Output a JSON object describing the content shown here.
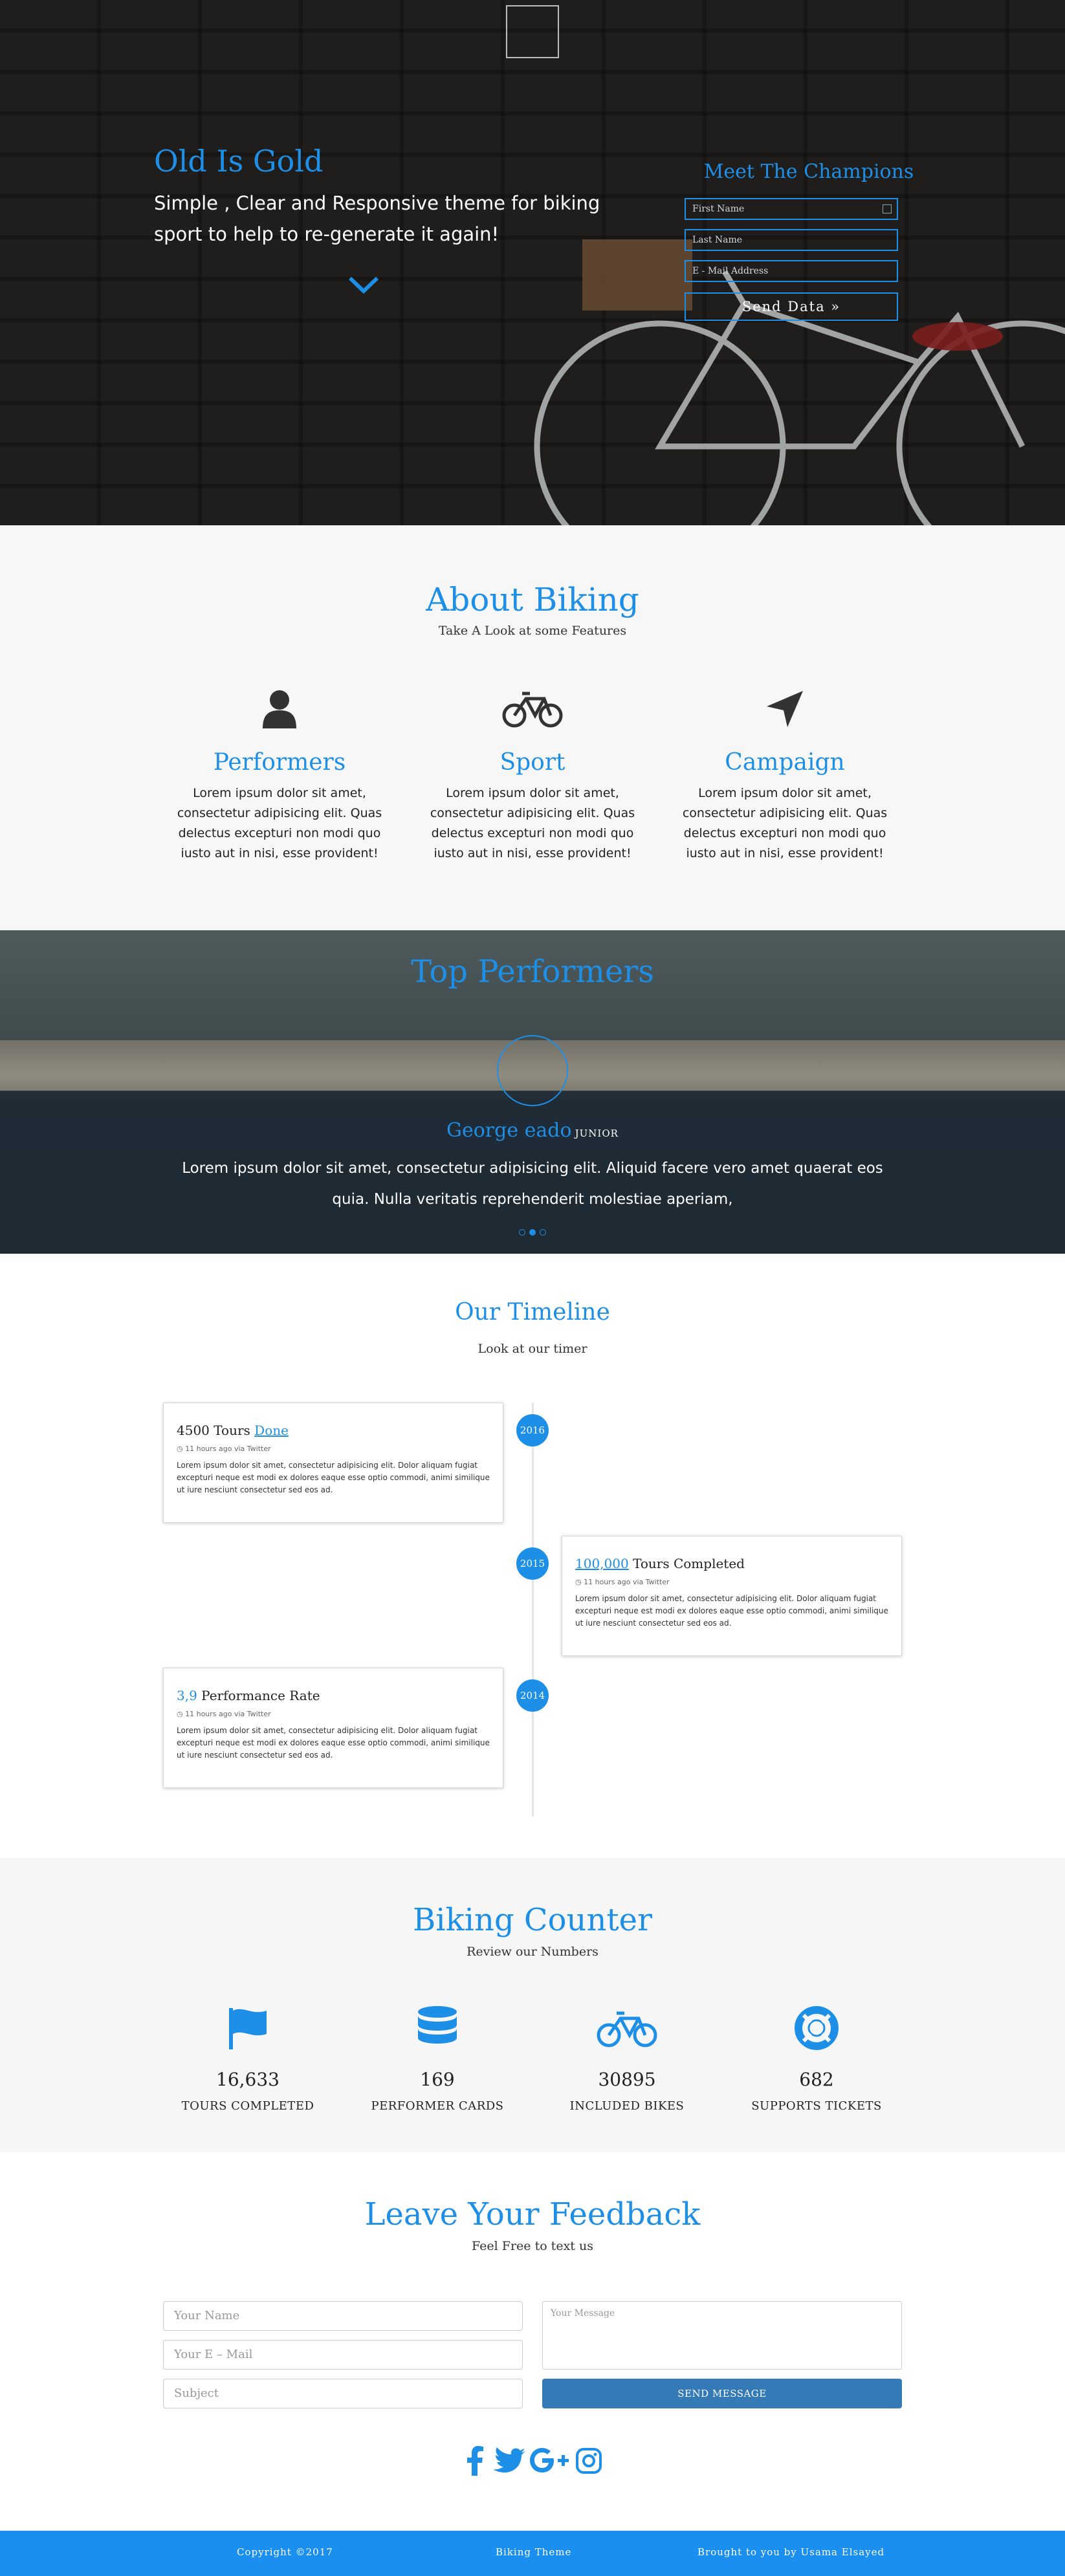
{
  "hero": {
    "title": "Old Is Gold",
    "subtitle": "Simple , Clear and Responsive theme for biking sport to help to re-generate it again!",
    "form": {
      "title": "Meet The Champions",
      "first_name_placeholder": "First Name",
      "last_name_placeholder": "Last Name",
      "email_placeholder": "E - Mail Address",
      "submit_label": "Send Data »"
    }
  },
  "about": {
    "title": "About Biking",
    "subtitle": "Take A Look at some Features",
    "features": [
      {
        "icon": "user-icon",
        "title": "Performers",
        "text": "Lorem ipsum dolor sit amet, consectetur adipisicing elit. Quas delectus excepturi non modi quo iusto aut in nisi, esse provident!"
      },
      {
        "icon": "bicycle-icon",
        "title": "Sport",
        "text": "Lorem ipsum dolor sit amet, consectetur adipisicing elit. Quas delectus excepturi non modi quo iusto aut in nisi, esse provident!"
      },
      {
        "icon": "location-arrow-icon",
        "title": "Campaign",
        "text": "Lorem ipsum dolor sit amet, consectetur adipisicing elit. Quas delectus excepturi non modi quo iusto aut in nisi, esse provident!"
      }
    ]
  },
  "performers": {
    "title": "Top Performers",
    "name": "George eado",
    "rank": "JUNIOR",
    "quote": "Lorem ipsum dolor sit amet, consectetur adipisicing elit. Aliquid facere vero amet quaerat eos quia. Nulla veritatis reprehenderit molestiae aperiam,",
    "active_slide": 2,
    "slide_count": 3
  },
  "timeline": {
    "title": "Our Timeline",
    "subtitle": "Look at our timer",
    "entries": [
      {
        "year": "2016",
        "highlight": "",
        "title_pre": "4500 Tours ",
        "title_link": "Done",
        "title_post": "",
        "meta": "11 hours ago via Twitter",
        "text": "Lorem ipsum dolor sit amet, consectetur adipisicing elit. Dolor aliquam fugiat excepturi neque est modi ex dolores eaque esse optio commodi, animi similique ut iure nesciunt consectetur sed eos ad."
      },
      {
        "year": "2015",
        "highlight": "100,000",
        "title_pre": "",
        "title_link": "",
        "title_post": " Tours Completed",
        "meta": "11 hours ago via Twitter",
        "text": "Lorem ipsum dolor sit amet, consectetur adipisicing elit. Dolor aliquam fugiat excepturi neque est modi ex dolores eaque esse optio commodi, animi similique ut iure nesciunt consectetur sed eos ad."
      },
      {
        "year": "2014",
        "highlight": "3,9",
        "title_pre": "",
        "title_link": "",
        "title_post": " Performance Rate",
        "meta": "11 hours ago via Twitter",
        "text": "Lorem ipsum dolor sit amet, consectetur adipisicing elit. Dolor aliquam fugiat excepturi neque est modi ex dolores eaque esse optio commodi, animi similique ut iure nesciunt consectetur sed eos ad."
      }
    ]
  },
  "counter": {
    "title": "Biking Counter",
    "subtitle": "Review our Numbers",
    "items": [
      {
        "icon": "flag-icon",
        "value": "16,633",
        "label": "TOURS COMPLETED"
      },
      {
        "icon": "database-icon",
        "value": "169",
        "label": "PERFORMER CARDS"
      },
      {
        "icon": "bicycle-icon",
        "value": "30895",
        "label": "INCLUDED BIKES"
      },
      {
        "icon": "life-ring-icon",
        "value": "682",
        "label": "SUPPORTS TICKETS"
      }
    ]
  },
  "feedback": {
    "title": "Leave Your Feedback",
    "subtitle": "Feel Free to text us",
    "name_placeholder": "Your Name",
    "email_placeholder": "Your E – Mail",
    "subject_placeholder": "Subject",
    "message_placeholder": "Your Message",
    "submit_label": "SEND MESSAGE",
    "social": [
      "facebook-icon",
      "twitter-icon",
      "google-plus-icon",
      "instagram-icon"
    ]
  },
  "footer": {
    "copyright": "Copyright ©2017",
    "theme": "Biking Theme",
    "credit": "Brought to you by Usama Elsayed"
  },
  "colors": {
    "accent": "#1e8fe6",
    "footer": "#1a8ff0",
    "button": "#337ab7"
  }
}
